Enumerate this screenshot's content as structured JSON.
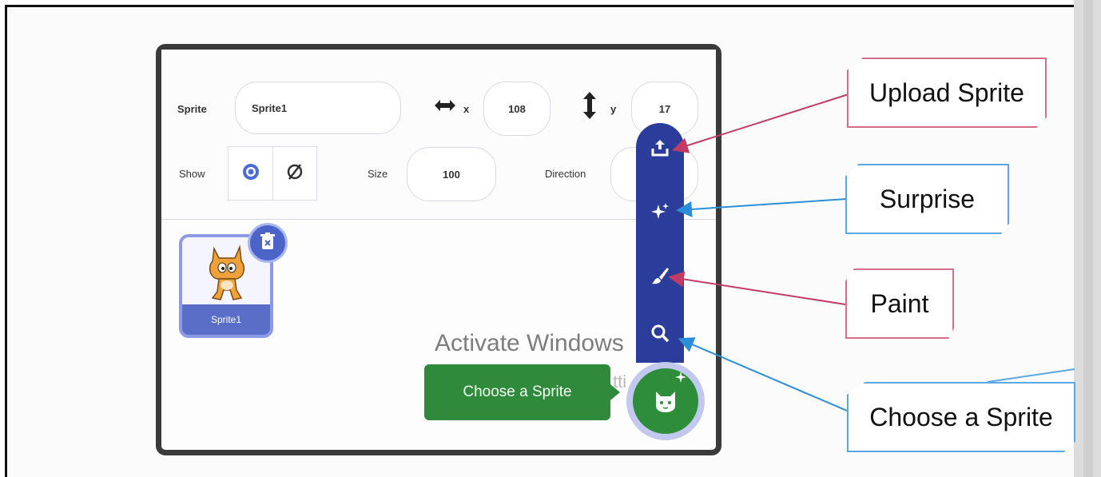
{
  "sprite_info": {
    "sprite_label": "Sprite",
    "sprite_name": "Sprite1",
    "x_label": "x",
    "x_value": "108",
    "y_label": "y",
    "y_value": "17",
    "show_label": "Show",
    "size_label": "Size",
    "size_value": "100",
    "direction_label": "Direction"
  },
  "sprite_list": {
    "tiles": [
      {
        "name": "Sprite1"
      }
    ],
    "watermark_title": "Activate Windows",
    "watermark_sub": "tti"
  },
  "sprite_menu": {
    "items": [
      "upload-icon",
      "surprise-icon",
      "paint-icon",
      "search-icon"
    ],
    "choose_sprite_tooltip": "Choose a Sprite"
  },
  "callouts": {
    "upload": "Upload Sprite",
    "surprise": "Surprise",
    "paint": "Paint",
    "choose": "Choose a Sprite"
  },
  "colors": {
    "menu_blue": "#2c3c9a",
    "choose_green": "#2f8a3c",
    "tile_blue": "#5b6ec7",
    "pink_arrow": "#c23b66",
    "blue_arrow": "#2a8fd6"
  }
}
